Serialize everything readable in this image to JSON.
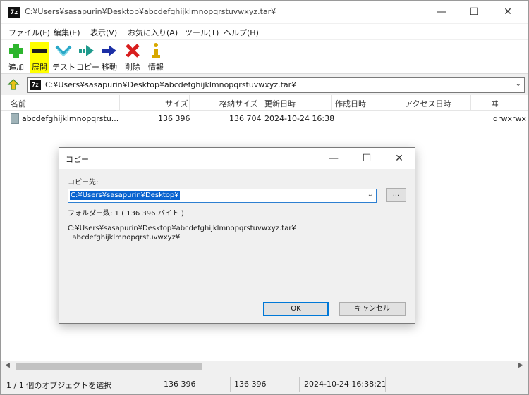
{
  "window": {
    "app_icon": "7z",
    "title": "C:¥Users¥sasapurin¥Desktop¥abcdefghijklmnopqrstuvwxyz.tar¥",
    "controls": {
      "minimize": "—",
      "maximize": "☐",
      "close": "✕"
    }
  },
  "menu": [
    "ファイル(F)",
    "編集(E)",
    "表示(V)",
    "お気に入り(A)",
    "ツール(T)",
    "ヘルプ(H)"
  ],
  "toolbar": [
    {
      "label": "追加",
      "icon": "add-icon",
      "color": "#2db52d"
    },
    {
      "label": "展開",
      "icon": "extract-icon",
      "color": "#1e1e1e",
      "highlighted": true
    },
    {
      "label": "テスト",
      "icon": "test-icon",
      "color": "#2aa8c8"
    },
    {
      "label": "コピー",
      "icon": "copy-icon",
      "color": "#1f9a8c"
    },
    {
      "label": "移動",
      "icon": "move-icon",
      "color": "#1c2fa6"
    },
    {
      "label": "削除",
      "icon": "delete-icon",
      "color": "#d81e1e"
    },
    {
      "label": "情報",
      "icon": "info-icon",
      "color": "#d8a800"
    }
  ],
  "address": {
    "icon": "7z",
    "path": "C:¥Users¥sasapurin¥Desktop¥abcdefghijklmnopqrstuvwxyz.tar¥"
  },
  "list": {
    "columns": [
      "名前",
      "サイズ",
      "格納サイズ",
      "更新日時",
      "作成日時",
      "アクセス日時",
      "ヰ"
    ],
    "rows": [
      {
        "name": "abcdefghijklmnopqrstu...",
        "size": "136 396",
        "packed": "136 704",
        "modified": "2024-10-24 16:38",
        "created": "",
        "accessed": "",
        "attributes": "drwxrwx"
      }
    ]
  },
  "statusbar": {
    "selection": "1 / 1 個のオブジェクトを選択",
    "size": "136 396",
    "packed": "136 396",
    "modified": "2024-10-24 16:38:21"
  },
  "dialog": {
    "title": "コピー",
    "dest_label": "コピー先:",
    "dest_value": "C:¥Users¥sasapurin¥Desktop¥",
    "browse_label": "...",
    "info": "フォルダー数: 1    ( 136 396 バイト )",
    "path_line1": "C:¥Users¥sasapurin¥Desktop¥abcdefghijklmnopqrstuvwxyz.tar¥",
    "path_line2": "  abcdefghijklmnopqrstuvwxyz¥",
    "ok_label": "OK",
    "cancel_label": "キャンセル"
  }
}
